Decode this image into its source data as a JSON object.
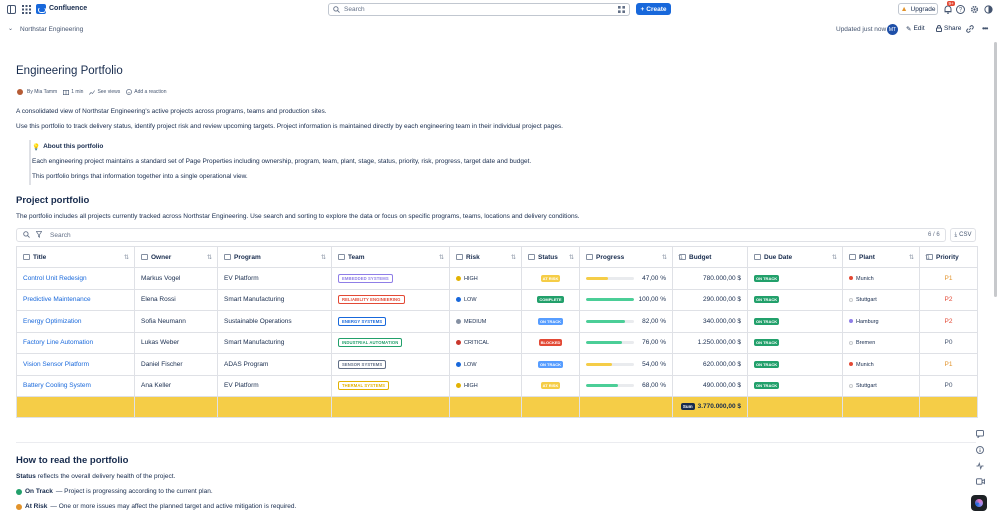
{
  "topbar": {
    "brand": "Confluence",
    "search_placeholder": "Search",
    "create_label": "Create",
    "upgrade_label": "Upgrade",
    "notifications_count": "9+"
  },
  "subbar": {
    "space_name": "Northstar Engineering",
    "updated": "Updated just now",
    "avatar_initials": "MT",
    "edit_label": "Edit",
    "share_label": "Share"
  },
  "page": {
    "title": "Engineering Portfolio",
    "byline": {
      "author": "By Mia Tamm",
      "read_time": "1 min",
      "views": "See views",
      "reaction": "Add a reaction"
    },
    "intro_1": "A consolidated view of Northstar Engineering's active projects across programs, teams and production sites.",
    "intro_2": "Use this portfolio to track delivery status, identify project risk and review upcoming targets. Project information is maintained directly by each engineering team in their individual project pages.",
    "panel": {
      "title": "About this portfolio",
      "line_1": "Each engineering project maintains a standard set of Page Properties including ownership, program, team, plant, stage, status, priority, risk, progress, target date and budget.",
      "line_2": "This portfolio brings that information together into a single operational view."
    },
    "section_1_title": "Project portfolio",
    "section_1_desc": "The portfolio includes all projects currently tracked across Northstar Engineering. Use search and sorting to explore the data or focus on specific programs, teams, locations and delivery conditions.",
    "section_2_title": "How to read the portfolio",
    "status_intro_bold": "Status",
    "status_intro_rest": "reflects the overall delivery health of the project.",
    "legend": [
      {
        "label": "On Track",
        "desc": "— Project is progressing according to the current plan.",
        "color": "#22a06b"
      },
      {
        "label": "At Risk",
        "desc": "— One or more issues may affect the planned target and active mitigation is required.",
        "color": "#e2932b"
      }
    ]
  },
  "table": {
    "search_placeholder": "Search",
    "count": "6 / 6",
    "csv_label": "CSV",
    "columns": [
      "Title",
      "Owner",
      "Program",
      "Team",
      "Risk",
      "Status",
      "Progress",
      "Budget",
      "Due Date",
      "Plant",
      "Priority"
    ],
    "rows": [
      {
        "title": "Control Unit Redesign",
        "owner": "Markus Vogel",
        "program": "EV Platform",
        "team": "EMBEDDED SYSTEMS",
        "team_color": "#8f7ee7",
        "risk": "HIGH",
        "risk_color": "#e2b203",
        "status": "AT RISK",
        "status_color": "#f5cd47",
        "progress": 47,
        "progress_label": "47,00 %",
        "progress_color": "#f5cd47",
        "budget": "780.000,00 $",
        "due": "ON TRACK",
        "plant": "Munich",
        "plant_color": "#e34935",
        "priority": "P1",
        "priority_color": "#e2932b"
      },
      {
        "title": "Predictive Maintenance",
        "owner": "Elena Rossi",
        "program": "Smart Manufacturing",
        "team": "RELIABILITY ENGINEERING",
        "team_color": "#e34935",
        "risk": "LOW",
        "risk_color": "#1868db",
        "status": "COMPLETE",
        "status_color": "#22a06b",
        "progress": 100,
        "progress_label": "100,00 %",
        "progress_color": "#4bce97",
        "budget": "290.000,00 $",
        "due": "ON TRACK",
        "plant": "Stuttgart",
        "plant_color": "#ffffff",
        "priority": "P2",
        "priority_color": "#e34935"
      },
      {
        "title": "Energy Optimization",
        "owner": "Sofia Neumann",
        "program": "Sustainable Operations",
        "team": "ENERGY SYSTEMS",
        "team_color": "#1868db",
        "risk": "MEDIUM",
        "risk_color": "#8590a2",
        "status": "ON TRACK",
        "status_color": "#579dff",
        "progress": 82,
        "progress_label": "82,00 %",
        "progress_color": "#4bce97",
        "budget": "340.000,00 $",
        "due": "ON TRACK",
        "plant": "Hamburg",
        "plant_color": "#8f7ee7",
        "priority": "P2",
        "priority_color": "#e34935"
      },
      {
        "title": "Factory Line Automation",
        "owner": "Lukas Weber",
        "program": "Smart Manufacturing",
        "team": "INDUSTRIAL AUTOMATION",
        "team_color": "#22a06b",
        "risk": "CRITICAL",
        "risk_color": "#c9372c",
        "status": "BLOCKED",
        "status_color": "#e34935",
        "progress": 76,
        "progress_label": "76,00 %",
        "progress_color": "#4bce97",
        "budget": "1.250.000,00 $",
        "due": "ON TRACK",
        "plant": "Bremen",
        "plant_color": "#ffffff",
        "priority": "P0",
        "priority_color": "#44546f"
      },
      {
        "title": "Vision Sensor Platform",
        "owner": "Daniel Fischer",
        "program": "ADAS Program",
        "team": "SENSOR SYSTEMS",
        "team_color": "#626f86",
        "risk": "LOW",
        "risk_color": "#1868db",
        "status": "ON TRACK",
        "status_color": "#579dff",
        "progress": 54,
        "progress_label": "54,00 %",
        "progress_color": "#f5cd47",
        "budget": "620.000,00 $",
        "due": "ON TRACK",
        "plant": "Munich",
        "plant_color": "#e34935",
        "priority": "P1",
        "priority_color": "#e2932b"
      },
      {
        "title": "Battery Cooling System",
        "owner": "Ana Keller",
        "program": "EV Platform",
        "team": "THERMAL SYSTEMS",
        "team_color": "#e2b203",
        "risk": "HIGH",
        "risk_color": "#e2b203",
        "status": "AT RISK",
        "status_color": "#f5cd47",
        "progress": 68,
        "progress_label": "68,00 %",
        "progress_color": "#4bce97",
        "budget": "490.000,00 $",
        "due": "ON TRACK",
        "plant": "Stuttgart",
        "plant_color": "#ffffff",
        "priority": "P0",
        "priority_color": "#44546f"
      }
    ],
    "summary_chip": "Sum",
    "summary_value": "3.770.000,00 $"
  },
  "colors": {
    "accent": "#1868db",
    "summary_row": "#f5cd47",
    "due_badge": "#22a06b"
  }
}
